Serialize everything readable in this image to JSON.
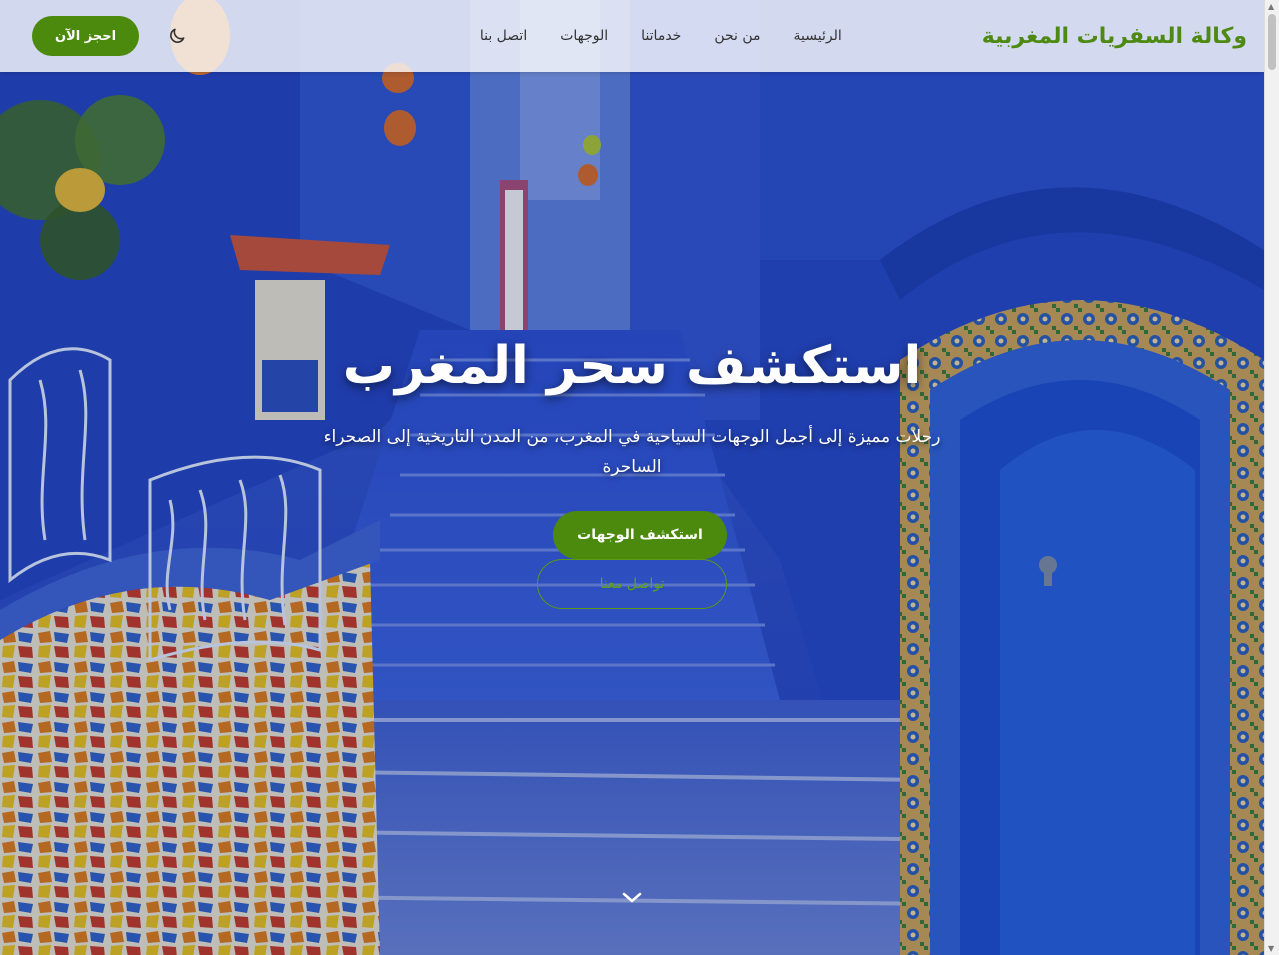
{
  "brand": "وكالة السفريات المغربية",
  "nav": {
    "links": [
      "الرئيسية",
      "من نحن",
      "خدماتنا",
      "الوجهات",
      "اتصل بنا"
    ],
    "book_label": "احجز الآن",
    "theme_icon": "moon-icon"
  },
  "hero": {
    "title": "استكشف سحر المغرب",
    "subtitle": "رحلات مميزة إلى أجمل الوجهات السياحية في المغرب، من المدن التاريخية إلى الصحراء الساحرة",
    "primary_label": "استكشف الوجهات",
    "secondary_label": "تواصل معنا",
    "scroll_icon": "chevron-down-icon"
  },
  "colors": {
    "brand_green": "#4b8a0c",
    "wall_blue": "#1f47c8"
  }
}
